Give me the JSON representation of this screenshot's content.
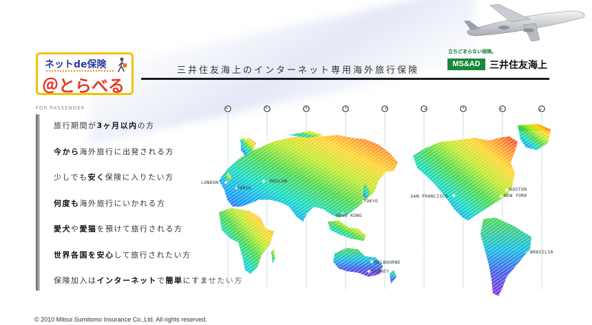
{
  "header": {
    "logo_top": "ネットde保険",
    "logo_main": "＠とらべる",
    "tagline": "三井住友海上のインターネット専用海外旅行保険",
    "brand_small": "立ちどまらない保険。",
    "brand_badge": "MS&AD",
    "brand_name": "三井住友海上"
  },
  "section_label": "FOR PASSENGER",
  "menu": [
    [
      {
        "t": "旅行期間が"
      },
      {
        "t": "3ヶ月以内",
        "b": true
      },
      {
        "t": "の方"
      }
    ],
    [
      {
        "t": "今から",
        "b": true
      },
      {
        "t": "海外旅行に出発される方"
      }
    ],
    [
      {
        "t": "少しでも"
      },
      {
        "t": "安く",
        "b": true
      },
      {
        "t": "保険に入りたい方"
      }
    ],
    [
      {
        "t": "何度も",
        "b": true
      },
      {
        "t": "海外旅行にいかれる方"
      }
    ],
    [
      {
        "t": "愛犬",
        "b": true
      },
      {
        "t": "や"
      },
      {
        "t": "愛猫",
        "b": true
      },
      {
        "t": "を預けて旅行される方"
      }
    ],
    [
      {
        "t": "世界各国を安心",
        "b": true
      },
      {
        "t": "して旅行されたい方"
      }
    ],
    [
      {
        "t": "保険加入は"
      },
      {
        "t": "インターネット",
        "b": true
      },
      {
        "t": "で"
      },
      {
        "t": "簡単",
        "b": true
      },
      {
        "t": "にすませたい方"
      }
    ]
  ],
  "cities": [
    "LONDON",
    "PARIS",
    "MOSCOW",
    "TOKYO",
    "HONG KONG",
    "SAN FRANCISCO",
    "BOSTON",
    "NEW YORK",
    "BRASILIA",
    "MELBOURNE",
    "SYDNEY"
  ],
  "colors": {
    "brand_green": "#1a8a3a",
    "logo_border": "#f2c200",
    "logo_red": "#e43a2a",
    "logo_blue": "#2a3b9a"
  },
  "footer": "© 2010 Mitsui Sumitomo Insurance Co.,Ltd. All rights reserved."
}
